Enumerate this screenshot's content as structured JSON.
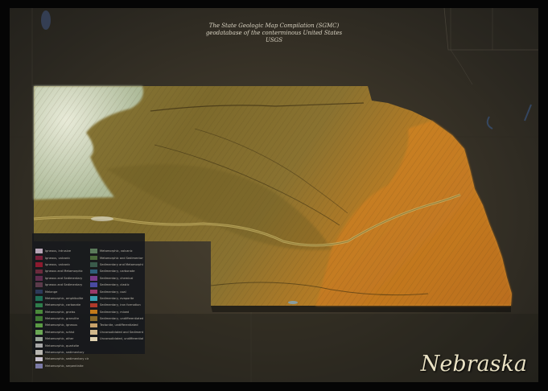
{
  "map": {
    "credit_lines": [
      "The State Geologic Map Compilation (SGMC)",
      "geodatabase of the conterminous United States",
      "USGS"
    ],
    "state_name": "Nebraska"
  },
  "legend": {
    "left_column": [
      {
        "label": "Igneous, intrusive",
        "color": "#b7a6b6"
      },
      {
        "label": "Igneous, volcanic",
        "color": "#7a1f3a"
      },
      {
        "label": "Igneous, volcanic",
        "color": "#8c1a2e"
      },
      {
        "label": "Igneous and Metamorphic",
        "color": "#6b2a3c"
      },
      {
        "label": "Igneous and Sedimentary",
        "color": "#5e2c4e"
      },
      {
        "label": "Igneous and Sedimentary",
        "color": "#5a3a4a"
      },
      {
        "label": "Melange",
        "color": "#2d3a5a"
      },
      {
        "label": "Metamorphic, amphibolite",
        "color": "#1f6f55"
      },
      {
        "label": "Metamorphic, carbonate",
        "color": "#2e7d4a"
      },
      {
        "label": "Metamorphic, gneiss",
        "color": "#4a8a3a"
      },
      {
        "label": "Metamorphic, granulite",
        "color": "#3f7a34"
      },
      {
        "label": "Metamorphic, igneous",
        "color": "#5a9a44"
      },
      {
        "label": "Metamorphic, schist",
        "color": "#6aa855"
      },
      {
        "label": "Metamorphic, other",
        "color": "#9aa59a"
      },
      {
        "label": "Metamorphic, quartzite",
        "color": "#a7a7a7"
      },
      {
        "label": "Metamorphic, sedimentary",
        "color": "#b8b6b0"
      },
      {
        "label": "Metamorphic, sedimentary clastic",
        "color": "#c9c3cf"
      },
      {
        "label": "Metamorphic, serpentinite",
        "color": "#7b7aa6"
      }
    ],
    "right_column": [
      {
        "label": "Metamorphic, volcanic",
        "color": "#5b7a5a"
      },
      {
        "label": "Metamorphic and Sedimentary",
        "color": "#4a6a3a"
      },
      {
        "label": "Sedimentary and Metamorphic",
        "color": "#3a5a4a"
      },
      {
        "label": "Sedimentary, carbonate",
        "color": "#2f5f7a"
      },
      {
        "label": "Sedimentary, chemical",
        "color": "#7a3a8a"
      },
      {
        "label": "Sedimentary, clastic",
        "color": "#4a4aa0"
      },
      {
        "label": "Sedimentary, coal",
        "color": "#9a3a6a"
      },
      {
        "label": "Sedimentary, evaporite",
        "color": "#3aa0b0"
      },
      {
        "label": "Sedimentary, iron formation",
        "color": "#b03a2a"
      },
      {
        "label": "Sedimentary, mixed",
        "color": "#c47a1a"
      },
      {
        "label": "Sedimentary, undifferentiated",
        "color": "#8a6a2a"
      },
      {
        "label": "Tectonite, undifferentiated",
        "color": "#c9a36a"
      },
      {
        "label": "Unconsolidated and Sedimentary",
        "color": "#d1b88a"
      },
      {
        "label": "Unconsolidated, undifferentiated",
        "color": "#e0d2b0"
      }
    ]
  }
}
